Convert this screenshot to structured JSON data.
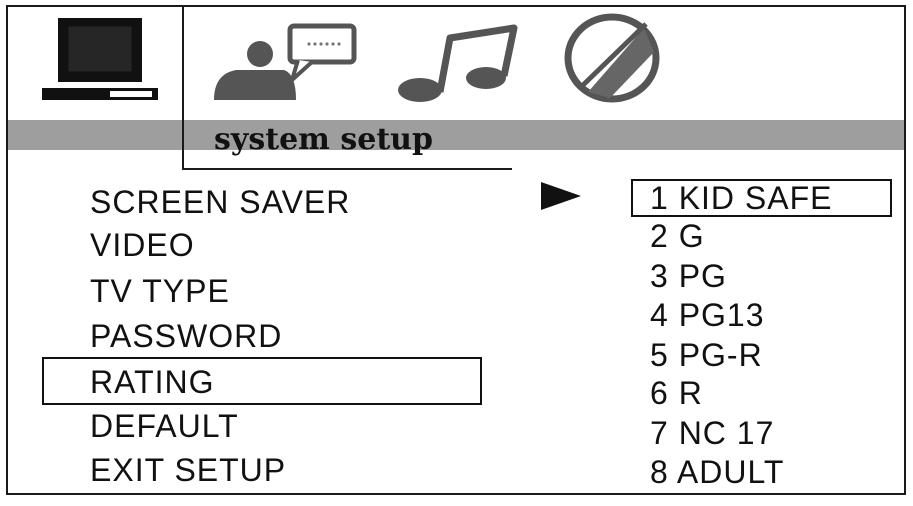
{
  "header": {
    "title": "system setup",
    "tabs": [
      {
        "icon": "monitor-icon",
        "active": true
      },
      {
        "icon": "speaker-person-icon",
        "active": false
      },
      {
        "icon": "music-note-icon",
        "active": false
      },
      {
        "icon": "slashed-circle-icon",
        "active": false
      }
    ]
  },
  "menu": {
    "items": [
      "SCREEN SAVER",
      "VIDEO",
      "TV TYPE",
      "PASSWORD",
      "RATING",
      "DEFAULT",
      "EXIT SETUP"
    ],
    "selected": "RATING"
  },
  "submenu": {
    "pointer": "▶",
    "options": [
      "1 KID SAFE",
      "2 G",
      "3 PG",
      "4 PG13",
      "5 PG-R",
      "6 R",
      "7 NC 17",
      "8 ADULT"
    ],
    "selected": "1 KID SAFE"
  }
}
